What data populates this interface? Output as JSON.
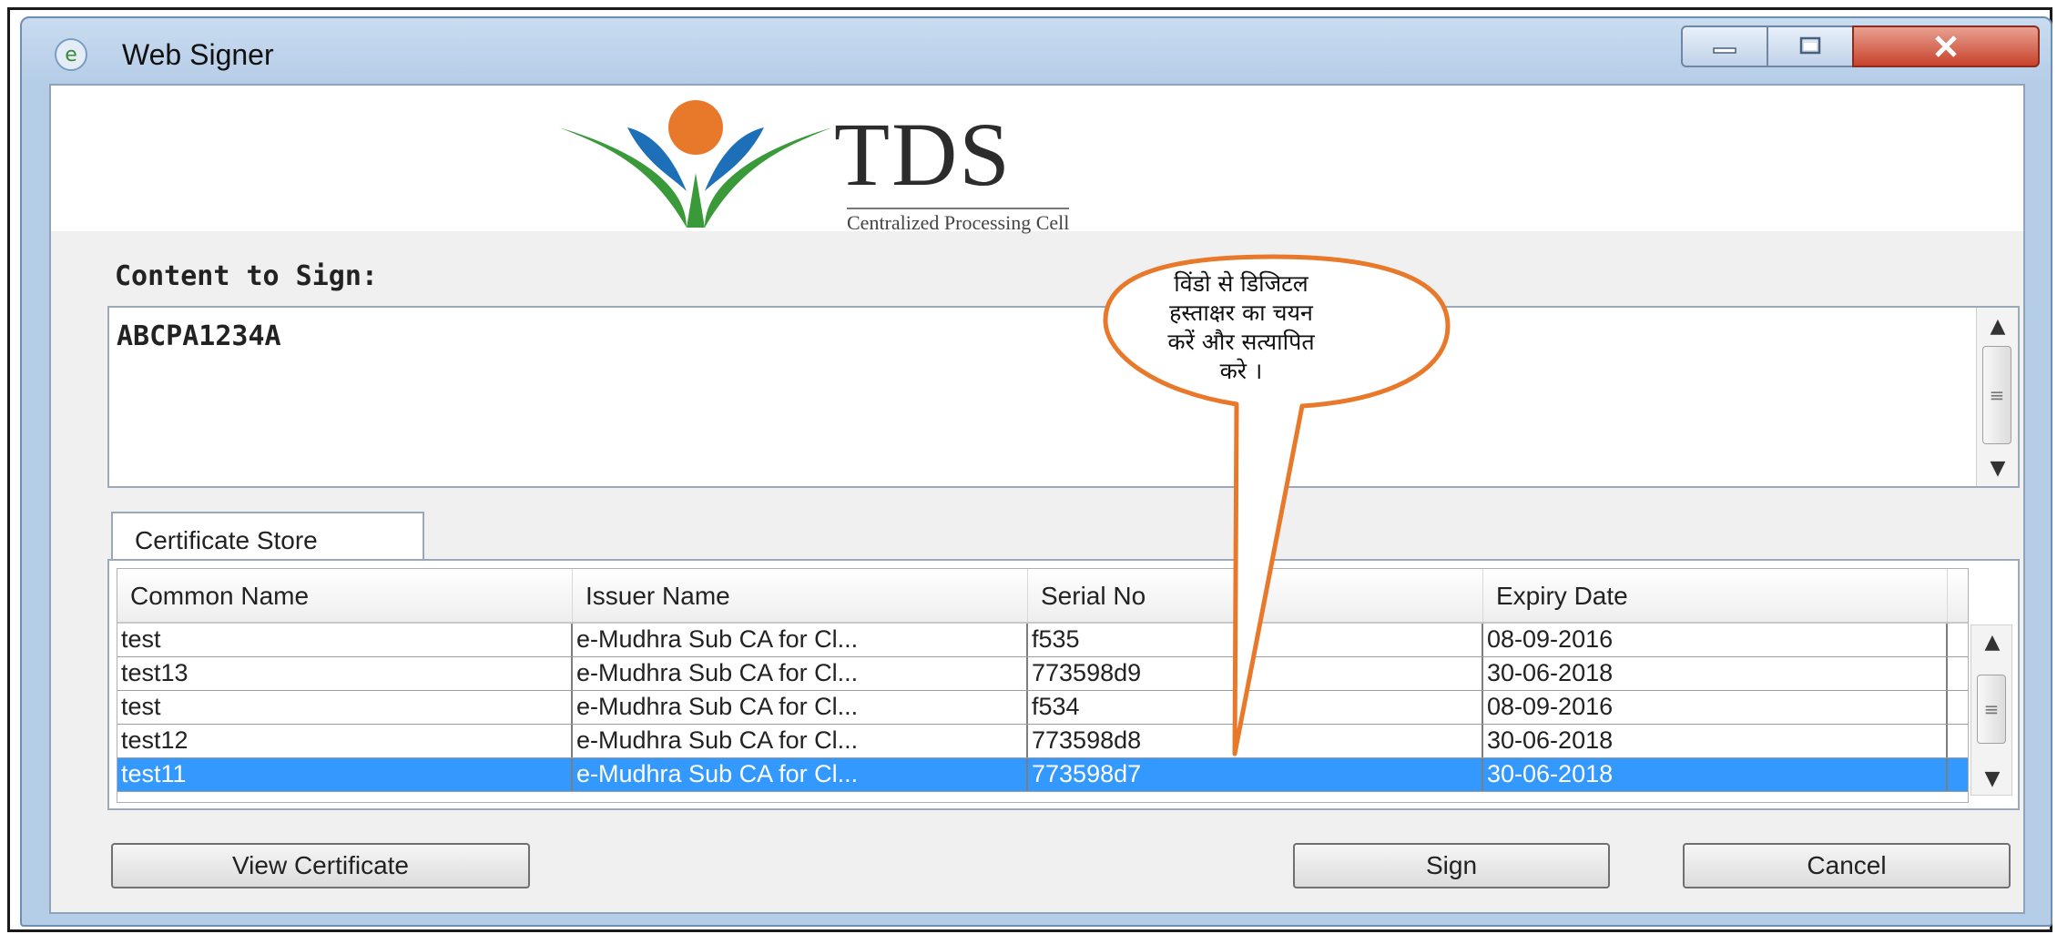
{
  "window": {
    "title": "Web Signer"
  },
  "banner": {
    "logo_text": "TDS",
    "logo_subtext": "Centralized Processing Cell"
  },
  "content": {
    "label": "Content to Sign:",
    "value": "ABCPA1234A"
  },
  "certificate_store": {
    "tab_label": "Certificate Store",
    "columns": [
      "Common Name",
      "Issuer Name",
      "Serial No",
      "Expiry Date"
    ],
    "rows": [
      {
        "common_name": "test",
        "issuer": "e-Mudhra Sub CA for Cl...",
        "serial": "f535",
        "expiry": "08-09-2016"
      },
      {
        "common_name": "test13",
        "issuer": "e-Mudhra Sub CA for Cl...",
        "serial": "773598d9",
        "expiry": "30-06-2018"
      },
      {
        "common_name": "test",
        "issuer": "e-Mudhra Sub CA for Cl...",
        "serial": "f534",
        "expiry": "08-09-2016"
      },
      {
        "common_name": "test12",
        "issuer": "e-Mudhra Sub CA for Cl...",
        "serial": "773598d8",
        "expiry": "30-06-2018"
      },
      {
        "common_name": "test11",
        "issuer": "e-Mudhra Sub CA for Cl...",
        "serial": "773598d7",
        "expiry": "30-06-2018"
      }
    ],
    "selected_row": 4
  },
  "buttons": {
    "view_certificate": "View Certificate",
    "sign": "Sign",
    "cancel": "Cancel"
  },
  "callout": {
    "lines": [
      "विंडो से डिजिटल",
      "हस्ताक्षर का चयन",
      "करें और सत्यापित",
      "करे ।"
    ]
  },
  "colors": {
    "selection": "#3399ff",
    "callout_border": "#e8792b",
    "logo_orange": "#e8792b",
    "logo_blue": "#1d6fb8",
    "logo_green": "#3a9a3a"
  },
  "icons": {
    "app": "web-signer-icon",
    "minimize": "minimize-icon",
    "maximize": "maximize-icon",
    "close": "close-icon"
  }
}
